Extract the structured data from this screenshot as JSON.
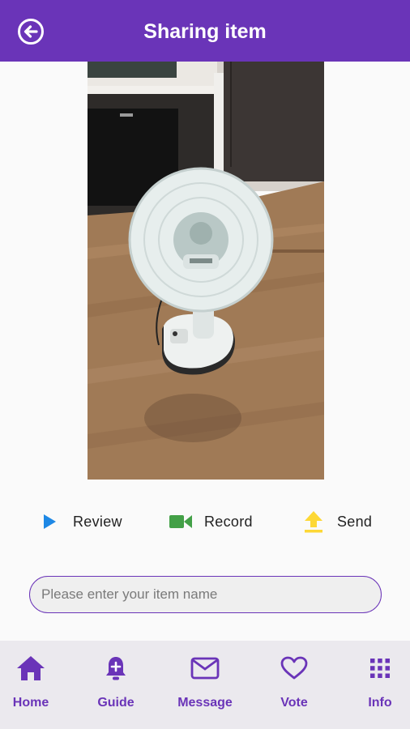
{
  "header": {
    "title": "Sharing item",
    "back_icon": "back-arrow-circle-icon"
  },
  "preview": {
    "subject": "standing electric fan on wooden floor"
  },
  "actions": [
    {
      "label": "Review",
      "icon": "play-icon",
      "color": "#1e88e5"
    },
    {
      "label": "Record",
      "icon": "video-camera-icon",
      "color": "#43a047"
    },
    {
      "label": "Send",
      "icon": "upload-icon",
      "color": "#fdd835"
    }
  ],
  "item_name": {
    "value": "",
    "placeholder": "Please enter your item name"
  },
  "bottom_nav": [
    {
      "label": "Home",
      "icon": "home-icon"
    },
    {
      "label": "Guide",
      "icon": "bell-plus-icon"
    },
    {
      "label": "Message",
      "icon": "mail-icon"
    },
    {
      "label": "Vote",
      "icon": "heart-icon"
    },
    {
      "label": "Info",
      "icon": "grid-icon"
    }
  ],
  "colors": {
    "primary": "#6a34b8",
    "nav_background": "#ebe9ee",
    "page_background": "#fafafa"
  }
}
